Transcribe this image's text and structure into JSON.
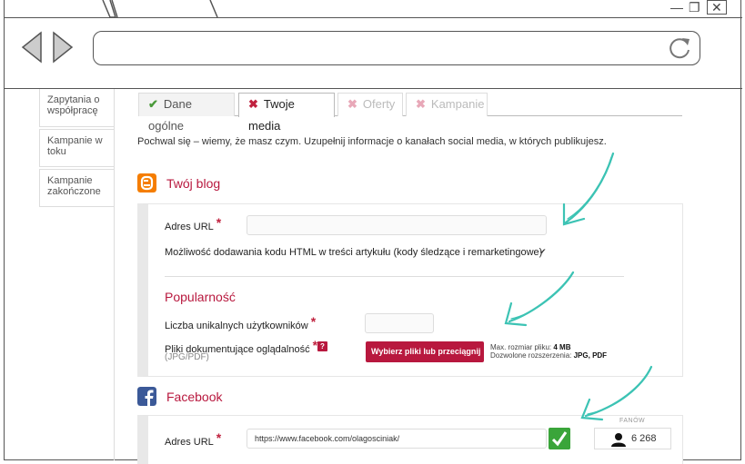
{
  "sidebar": {
    "items": [
      {
        "label": "Zapytania o współpracę"
      },
      {
        "label": "Kampanie w toku"
      },
      {
        "label": "Kampanie zakończone"
      }
    ]
  },
  "tabs": [
    {
      "label": "Dane ogólne",
      "mark": "✔",
      "state": "done"
    },
    {
      "label": "Twoje media",
      "mark": "✖",
      "state": "active"
    },
    {
      "label": "Oferty",
      "mark": "✖",
      "state": "disabled"
    },
    {
      "label": "Kampanie",
      "mark": "✖",
      "state": "disabled"
    }
  ],
  "intro": "Pochwal się – wiemy, że masz czym. Uzupełnij informacje o kanałach social media, w których publikujesz.",
  "blog": {
    "icon": "blogger-icon",
    "title": "Twój blog",
    "url_label": "Adres URL",
    "url_value": "",
    "html_label": "Możliwość dodawania kodu HTML w treści artykułu (kody śledzące i remarketingowe)",
    "html_checked": true,
    "popularity_title": "Popularność",
    "users_label": "Liczba unikalnych użytkowników",
    "files_label": "Pliki dokumentujące oglądalność",
    "files_sub": "(JPG/PDF)",
    "help": "?",
    "upload_button": "Wybierz pliki lub przeciągnij",
    "max_size_label": "Max. rozmiar pliku:",
    "max_size_value": "4 MB",
    "ext_label": "Dozwolone rozszerzenia:",
    "ext_value": "JPG, PDF"
  },
  "facebook": {
    "icon": "facebook-icon",
    "title": "Facebook",
    "url_label": "Adres URL",
    "url_value": "https://www.facebook.com/olagosciniak/",
    "fans_label": "FANÓW",
    "fans_value": "6 268"
  },
  "colors": {
    "accent": "#b8183e",
    "ok": "#3aa53a",
    "arrow": "#3cc3b4"
  }
}
